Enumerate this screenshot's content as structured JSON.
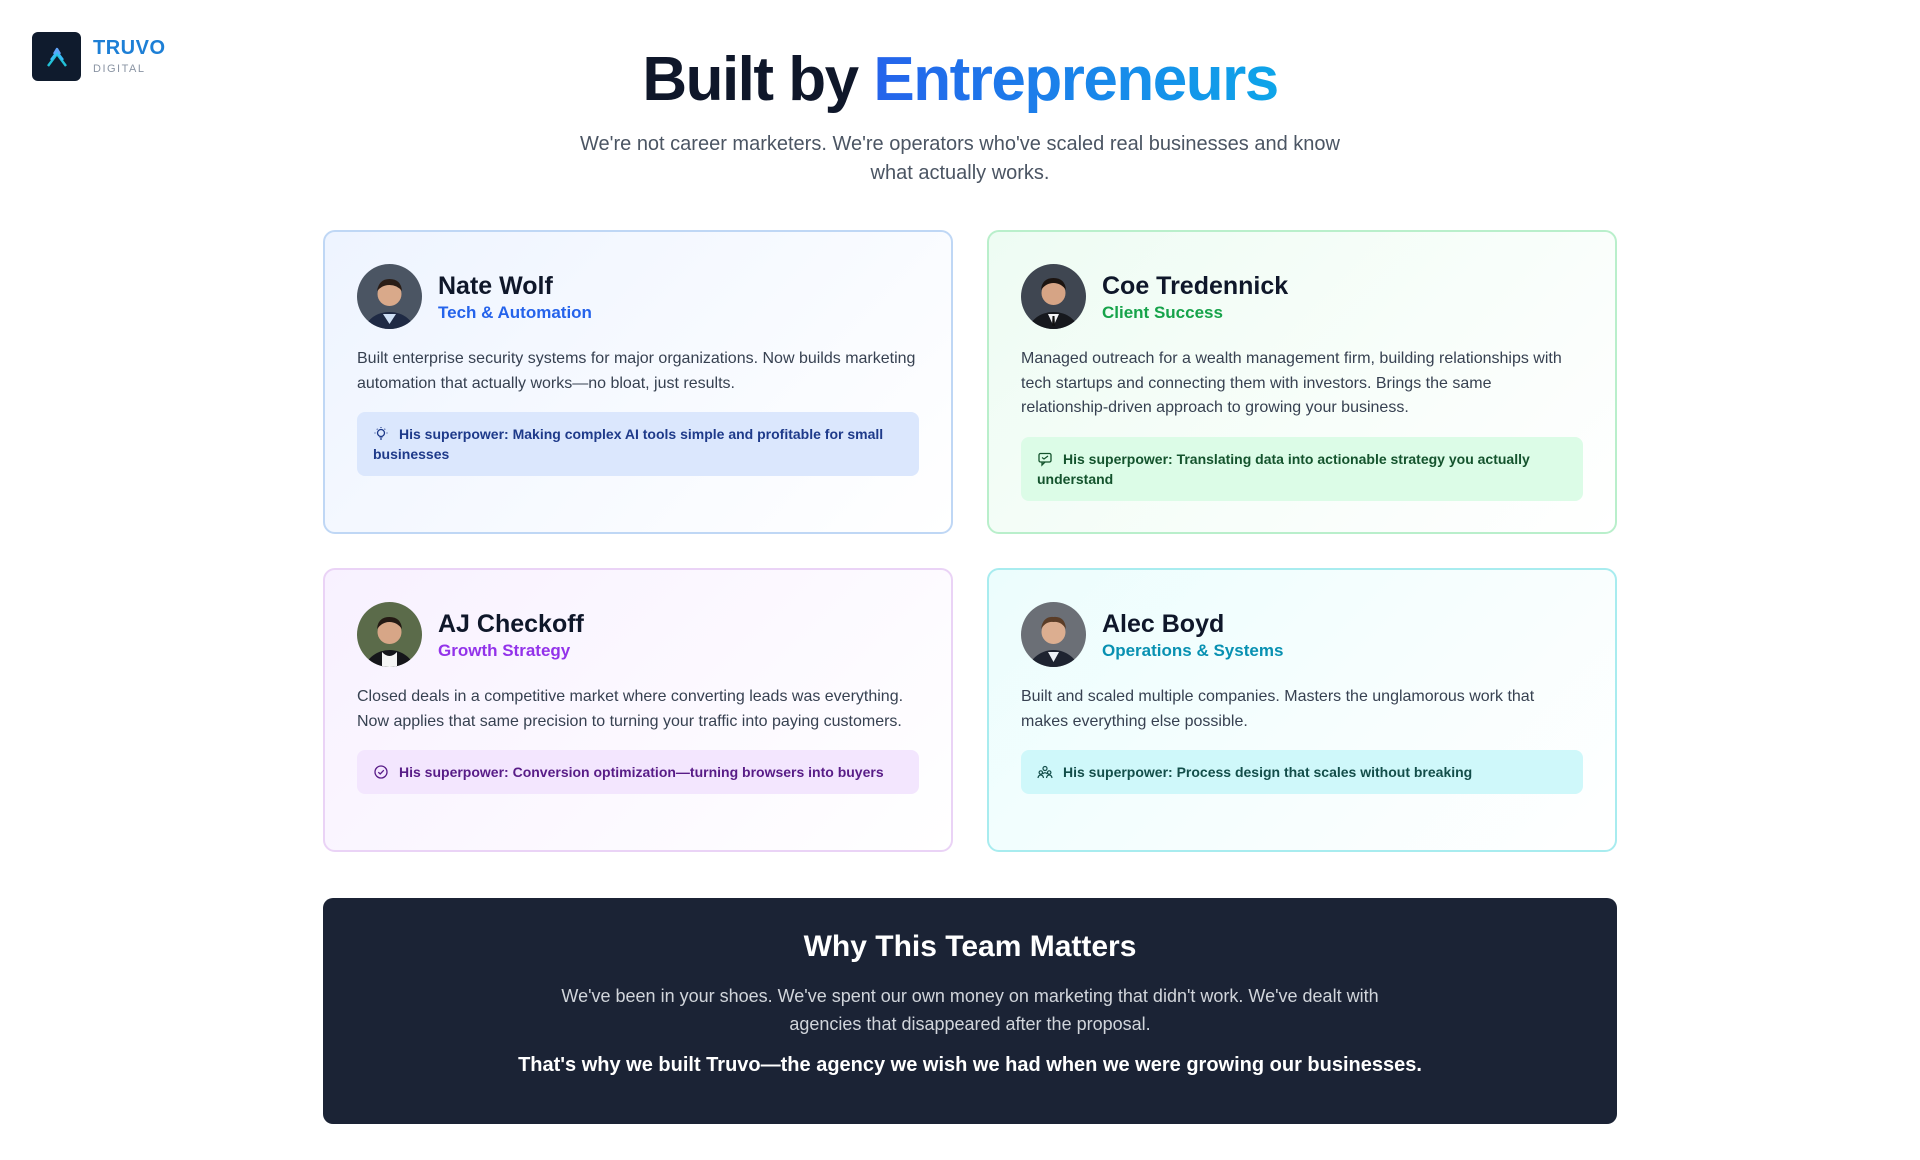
{
  "brand": {
    "name": "TRUVO",
    "sub": "DIGITAL",
    "colors": {
      "accent": "#1d7fd6",
      "mark_bg": "#0f1b2d"
    }
  },
  "hero": {
    "title_prefix": "Built by",
    "title_accent": "Entrepreneurs",
    "subtitle": "We're not career marketers. We're operators who've scaled real businesses and know what actually works."
  },
  "team": [
    {
      "name": "Nate Wolf",
      "role": "Tech & Automation",
      "bio": "Built enterprise security systems for major organizations. Now builds marketing automation that actually works—no bloat, just results.",
      "superpower": "His superpower: Making complex AI tools simple and profitable for small businesses",
      "icon": "lightbulb-icon",
      "color": "#2563eb"
    },
    {
      "name": "Coe Tredennick",
      "role": "Client Success",
      "bio": "Managed outreach for a wealth management firm, building relationships with tech startups and connecting them with investors. Brings the same relationship-driven approach to growing your business.",
      "superpower": "His superpower: Translating data into actionable strategy you actually understand",
      "icon": "chat-icon",
      "color": "#16a34a"
    },
    {
      "name": "AJ Checkoff",
      "role": "Growth Strategy",
      "bio": "Closed deals in a competitive market where converting leads was everything. Now applies that same precision to turning your traffic into paying customers.",
      "superpower": "His superpower: Conversion optimization—turning browsers into buyers",
      "icon": "check-circle-icon",
      "color": "#9333ea"
    },
    {
      "name": "Alec Boyd",
      "role": "Operations & Systems",
      "bio": "Built and scaled multiple companies. Masters the unglamorous work that makes everything else possible.",
      "superpower": "His superpower: Process design that scales without breaking",
      "icon": "team-icon",
      "color": "#0891b2"
    }
  ],
  "why": {
    "title": "Why This Team Matters",
    "body": "We've been in your shoes. We've spent our own money on marketing that didn't work. We've dealt with agencies that disappeared after the proposal.",
    "punch": "That's why we built Truvo—the agency we wish we had when we were growing our businesses."
  }
}
